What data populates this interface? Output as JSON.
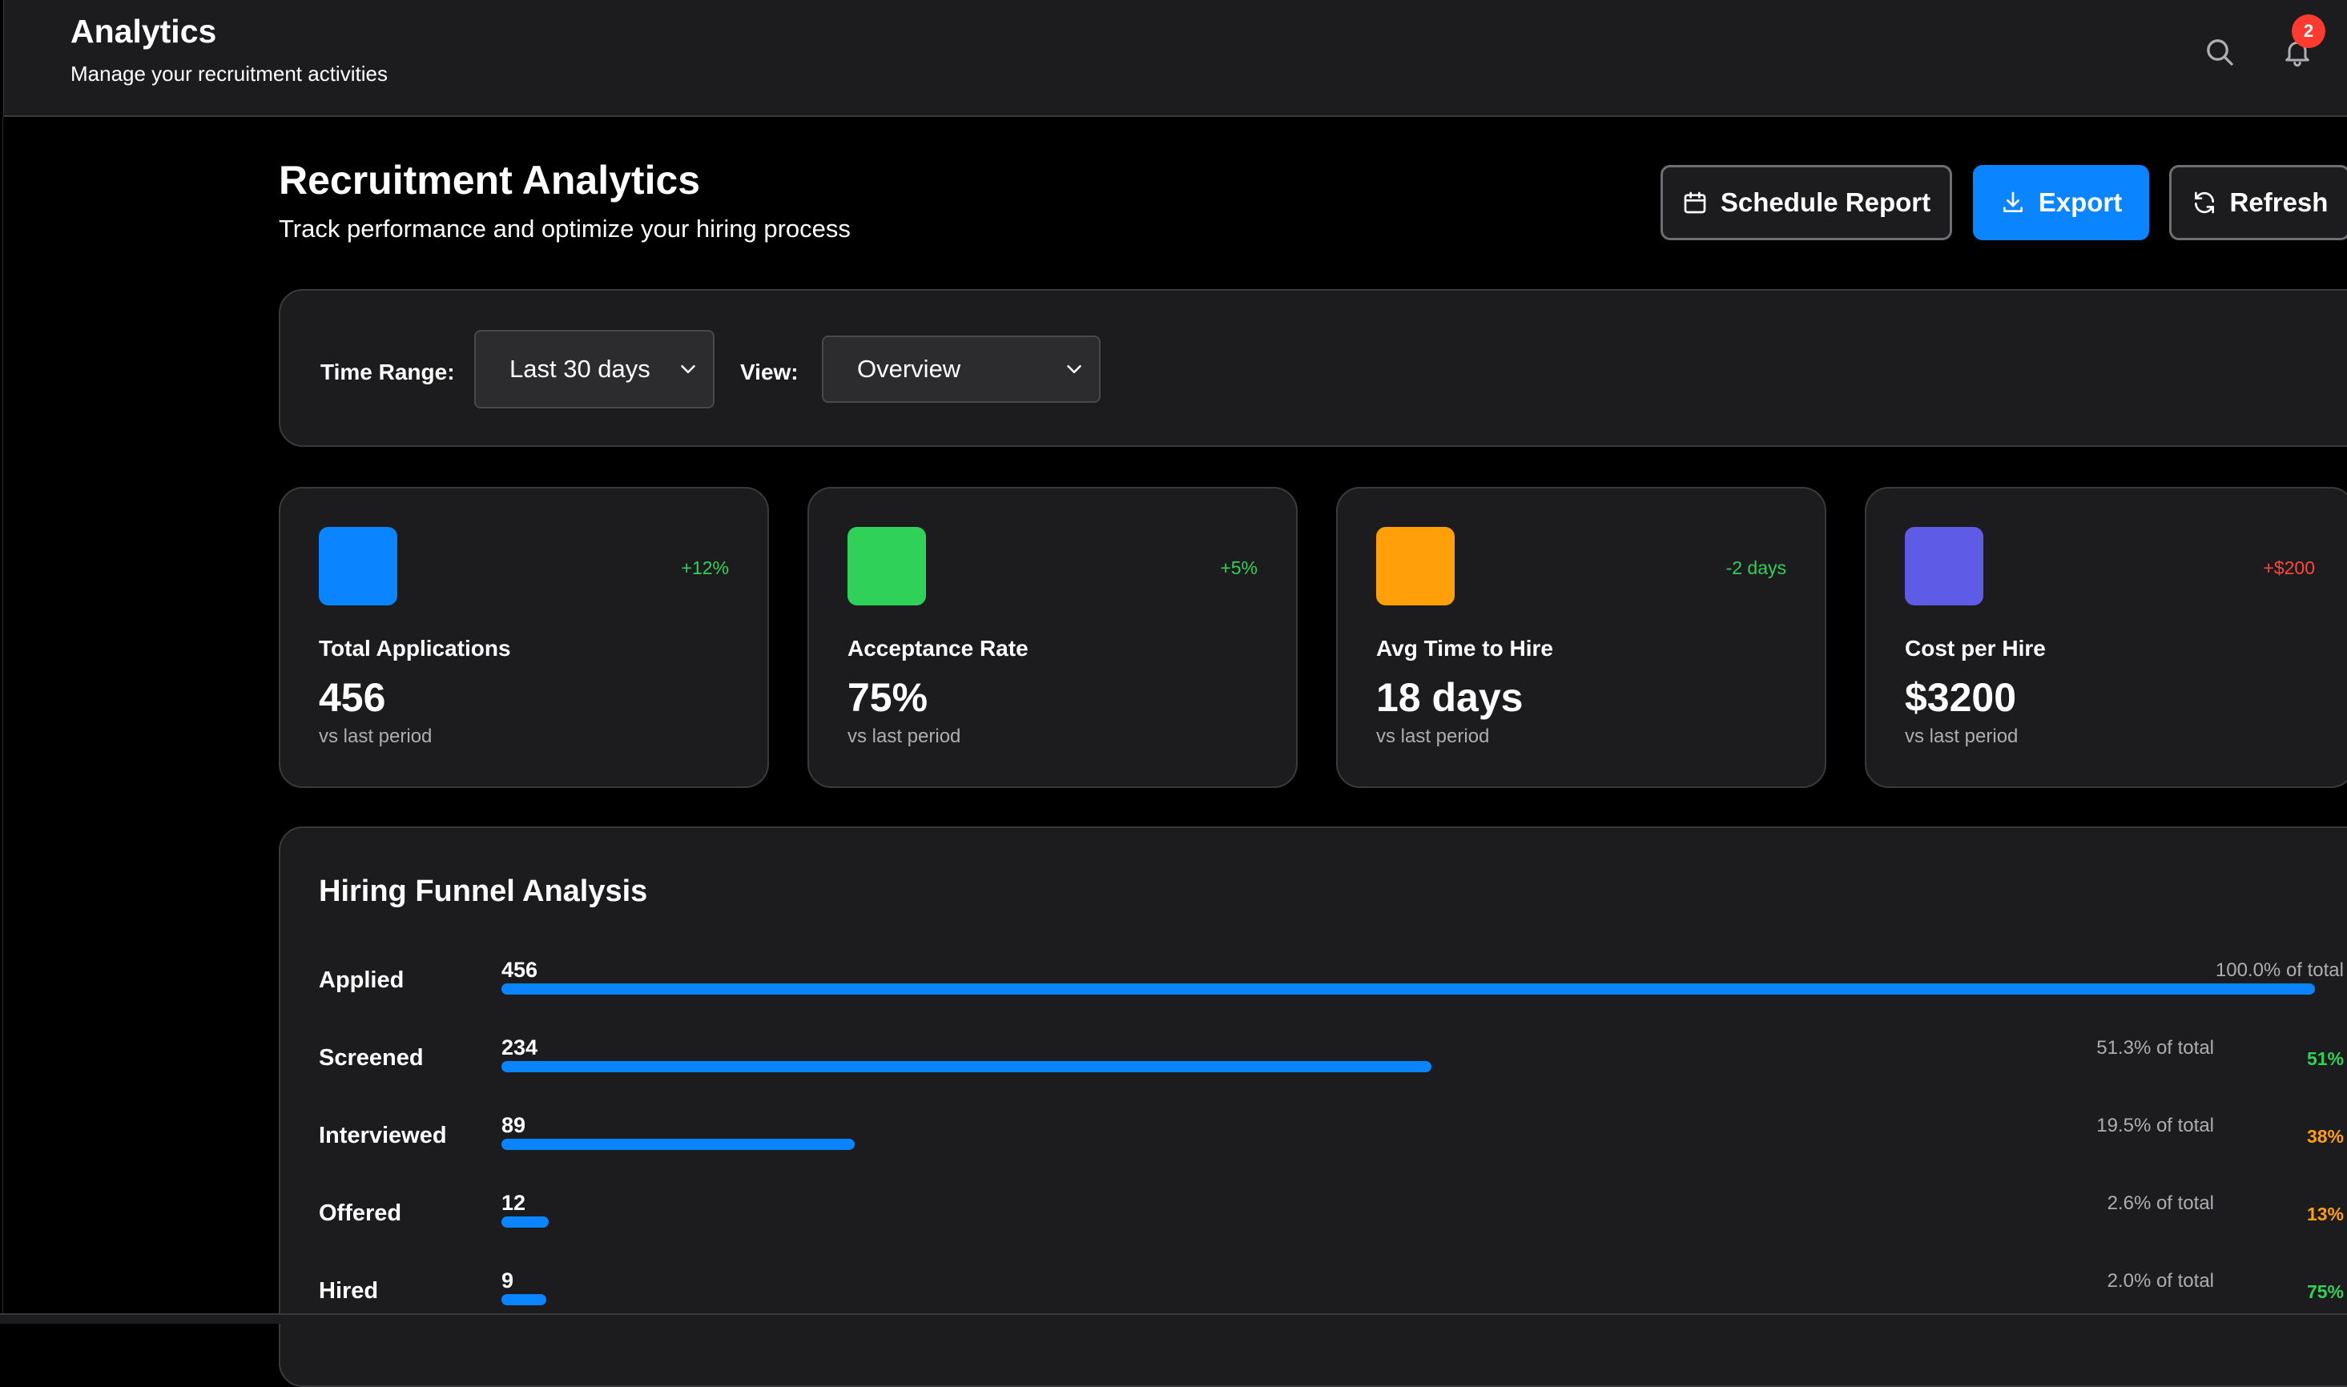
{
  "header": {
    "title": "Analytics",
    "subtitle": "Manage your recruitment activities",
    "notification_count": "2",
    "search_icon": "search-icon",
    "bell_icon": "bell-icon"
  },
  "page": {
    "title": "Recruitment Analytics",
    "subtitle": "Track performance and optimize your hiring process"
  },
  "actions": {
    "schedule_label": "Schedule Report",
    "export_label": "Export",
    "refresh_label": "Refresh"
  },
  "filters": {
    "time_range_label": "Time Range:",
    "time_range_value": "Last 30 days",
    "view_label": "View:",
    "view_value": "Overview"
  },
  "stats": [
    {
      "label": "Total Applications",
      "value": "456",
      "change": "+12%",
      "sub": "vs last period",
      "color": "#0a84ff",
      "change_color": "#30d158"
    },
    {
      "label": "Acceptance Rate",
      "value": "75%",
      "change": "+5%",
      "sub": "vs last period",
      "color": "#30d158",
      "change_color": "#30d158"
    },
    {
      "label": "Avg Time to Hire",
      "value": "18 days",
      "change": "-2 days",
      "sub": "vs last period",
      "color": "#ff9f0a",
      "change_color": "#30d158"
    },
    {
      "label": "Cost per Hire",
      "value": "$3200",
      "change": "+$200",
      "sub": "vs last period",
      "color": "#5e5ce6",
      "change_color": "#ff453a"
    }
  ],
  "funnel": {
    "title": "Hiring Funnel Analysis",
    "stages": [
      {
        "stage": "Applied",
        "count": "456",
        "pct_total": "100.0% of total",
        "fill": 1.0,
        "conversion": ""
      },
      {
        "stage": "Screened",
        "count": "234",
        "pct_total": "51.3% of total",
        "fill": 0.513,
        "conversion": "51%",
        "conversion_color": "#30d158"
      },
      {
        "stage": "Interviewed",
        "count": "89",
        "pct_total": "19.5% of total",
        "fill": 0.195,
        "conversion": "38%",
        "conversion_color": "#ff9f0a"
      },
      {
        "stage": "Offered",
        "count": "12",
        "pct_total": "2.6% of total",
        "fill": 0.026,
        "conversion": "13%",
        "conversion_color": "#ff9f0a"
      },
      {
        "stage": "Hired",
        "count": "9",
        "pct_total": "2.0% of total",
        "fill": 0.02,
        "conversion": "75%",
        "conversion_color": "#30d158"
      }
    ]
  },
  "colors": {
    "accent": "#0a84ff",
    "background": "#000000",
    "surface": "#1c1c1e",
    "positive": "#30d158",
    "warning": "#ff9f0a",
    "negative": "#ff453a"
  }
}
